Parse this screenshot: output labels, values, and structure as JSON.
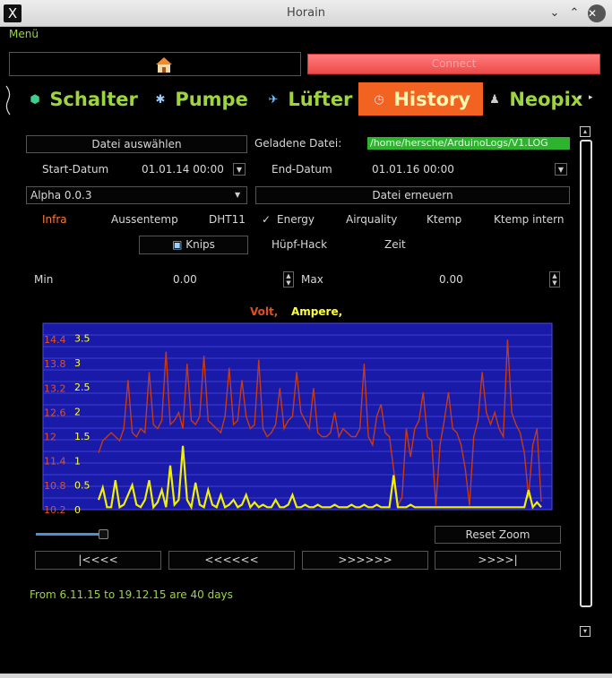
{
  "window": {
    "title": "Horain",
    "app_icon": "x-icon"
  },
  "menu": {
    "label": "Menü"
  },
  "toolbar": {
    "home_icon": "home-icon",
    "connect_label": "Connect"
  },
  "tabs": [
    {
      "label": "Schalter",
      "icon": "shield-icon"
    },
    {
      "label": "Pumpe",
      "icon": "gear-icon"
    },
    {
      "label": "Lüfter",
      "icon": "fan-icon"
    },
    {
      "label": "History",
      "icon": "clock-icon",
      "active": true
    },
    {
      "label": "Neopix",
      "icon": "light-icon"
    }
  ],
  "file": {
    "select_label": "Datei auswählen",
    "loaded_label": "Geladene Datei:",
    "path": "/home/hersche/ArduinoLogs/V1.LOG"
  },
  "dates": {
    "start_label": "Start-Datum",
    "start_value": "01.01.14 00:00",
    "end_label": "End-Datum",
    "end_value": "01.01.16 00:00"
  },
  "version": {
    "value": "Alpha 0.0.3",
    "refresh_label": "Datei erneuern"
  },
  "filters": {
    "infra": "Infra",
    "aussentemp": "Aussentemp",
    "dht11": "DHT11",
    "energy": "Energy",
    "energy_checked": "✓",
    "airquality": "Airquality",
    "ktemp": "Ktemp",
    "ktemp_intern": "Ktemp intern",
    "knips": "Knips",
    "huepf": "Hüpf-Hack",
    "zeit": "Zeit"
  },
  "range": {
    "min_label": "Min",
    "min_value": "0.00",
    "max_label": "Max",
    "max_value": "0.00"
  },
  "colors": {
    "accent_green": "#9cd63c",
    "volt": "#c83a10",
    "ampere": "#f0f000",
    "tab_active": "#f26322",
    "plot_bg": "#1a1aa8"
  },
  "chart_data": {
    "type": "line",
    "legend": [
      {
        "name": "Volt",
        "suffix": ",",
        "color": "#c83a10"
      },
      {
        "name": "Ampere",
        "suffix": ",",
        "color": "#f0f000"
      }
    ],
    "left_ticks": [
      "14.4",
      "13.8",
      "13.2",
      "12.6",
      "12",
      "11.4",
      "10.8",
      "10.2"
    ],
    "right_ticks": [
      "3.5",
      "3",
      "2.5",
      "2",
      "1.5",
      "1",
      "0.5",
      "0"
    ],
    "ylim_volt": [
      10.2,
      14.8
    ],
    "ylim_ampere": [
      0,
      3.8
    ],
    "series": [
      {
        "name": "Volt",
        "color": "#c83a10",
        "values": [
          11.6,
          11.9,
          12.0,
          12.1,
          12.0,
          11.9,
          12.2,
          13.4,
          12.1,
          12.0,
          12.2,
          12.1,
          13.6,
          12.3,
          12.2,
          12.4,
          14.1,
          12.3,
          12.4,
          12.6,
          12.2,
          13.8,
          12.4,
          12.3,
          12.5,
          14.0,
          12.4,
          12.3,
          12.2,
          12.1,
          12.5,
          13.7,
          12.3,
          12.4,
          13.4,
          12.5,
          12.2,
          12.3,
          13.9,
          12.2,
          12.0,
          12.1,
          12.3,
          13.2,
          12.2,
          12.4,
          12.5,
          13.6,
          12.6,
          12.4,
          12.2,
          13.2,
          12.1,
          12.0,
          12.0,
          12.1,
          12.6,
          12.0,
          12.2,
          12.1,
          12.0,
          12.0,
          12.2,
          13.8,
          12.0,
          11.8,
          12.5,
          12.8,
          12.1,
          12.0,
          11.2,
          10.3,
          10.5,
          12.2,
          11.5,
          12.2,
          12.4,
          13.1,
          12.0,
          11.9,
          10.3,
          11.8,
          12.4,
          13.1,
          12.2,
          12.1,
          11.8,
          11.2,
          10.3,
          12.0,
          12.4,
          13.6,
          12.6,
          12.3,
          12.6,
          12.2,
          12.0,
          14.4,
          12.6,
          12.3,
          12.1,
          11.6,
          10.5,
          11.8,
          12.2,
          10.4
        ]
      },
      {
        "name": "Ampere",
        "color": "#f0f000",
        "values": [
          0.2,
          0.45,
          0.05,
          0.05,
          0.6,
          0.05,
          0.1,
          0.3,
          0.5,
          0.1,
          0.05,
          0.2,
          0.6,
          0.05,
          0.15,
          0.4,
          0.05,
          0.9,
          0.1,
          0.2,
          1.3,
          0.2,
          0.05,
          0.55,
          0.1,
          0.05,
          0.4,
          0.1,
          0.05,
          0.3,
          0.05,
          0.1,
          0.2,
          0.05,
          0.1,
          0.3,
          0.05,
          0.15,
          0.05,
          0.1,
          0.05,
          0.05,
          0.2,
          0.05,
          0.05,
          0.1,
          0.3,
          0.05,
          0.05,
          0.1,
          0.05,
          0.05,
          0.1,
          0.05,
          0.05,
          0.05,
          0.1,
          0.05,
          0.05,
          0.05,
          0.1,
          0.05,
          0.05,
          0.1,
          0.05,
          0.05,
          0.1,
          0.05,
          0.05,
          0.05,
          0.7,
          0.05,
          0.05,
          0.05,
          0.1,
          0.05,
          0.05,
          0.05,
          0.05,
          0.05,
          0.05,
          0.05,
          0.05,
          0.05,
          0.05,
          0.05,
          0.05,
          0.05,
          0.05,
          0.05,
          0.05,
          0.05,
          0.05,
          0.05,
          0.05,
          0.05,
          0.05,
          0.05,
          0.05,
          0.05,
          0.05,
          0.05,
          0.4,
          0.05,
          0.15,
          0.05
        ]
      }
    ]
  },
  "zoom": {
    "reset_label": "Reset Zoom",
    "slider_value": 0.13
  },
  "nav": {
    "first": "|<<<<",
    "back": "<<<<<<",
    "forward": ">>>>>>",
    "last": ">>>>|"
  },
  "status": {
    "text": "From 6.11.15 to 19.12.15 are 40 days"
  }
}
